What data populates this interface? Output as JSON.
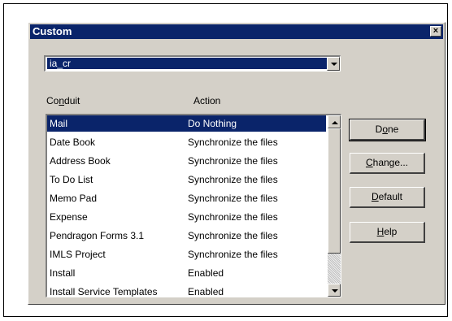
{
  "window": {
    "title": "Custom",
    "close_glyph": "×"
  },
  "user_combo": {
    "value": "ia_cr"
  },
  "columns": {
    "conduit": "Conduit",
    "conduit_mnemonic": "n",
    "action": "Action"
  },
  "rows": [
    {
      "conduit": "Mail",
      "action": "Do Nothing",
      "selected": true
    },
    {
      "conduit": "Date Book",
      "action": "Synchronize the files"
    },
    {
      "conduit": "Address Book",
      "action": "Synchronize the files"
    },
    {
      "conduit": "To Do List",
      "action": "Synchronize the files"
    },
    {
      "conduit": "Memo Pad",
      "action": "Synchronize the files"
    },
    {
      "conduit": "Expense",
      "action": "Synchronize the files"
    },
    {
      "conduit": "Pendragon Forms 3.1",
      "action": "Synchronize the files"
    },
    {
      "conduit": "IMLS Project",
      "action": "Synchronize the files"
    },
    {
      "conduit": "Install",
      "action": "Enabled"
    },
    {
      "conduit": "Install Service Templates",
      "action": "Enabled"
    }
  ],
  "buttons": {
    "done": {
      "pre": "D",
      "mn": "o",
      "post": "ne"
    },
    "change": {
      "pre": "",
      "mn": "C",
      "post": "hange..."
    },
    "default": {
      "pre": "",
      "mn": "D",
      "post": "efault"
    },
    "help": {
      "pre": "",
      "mn": "H",
      "post": "elp"
    }
  },
  "colors": {
    "titlebar": "#0a246a",
    "selection": "#0a246a",
    "dialog_face": "#d4d0c8"
  },
  "icons": {
    "close": "close-icon",
    "combo_arrow": "chevron-down-icon",
    "scroll_up": "scroll-up-icon",
    "scroll_down": "scroll-down-icon"
  }
}
